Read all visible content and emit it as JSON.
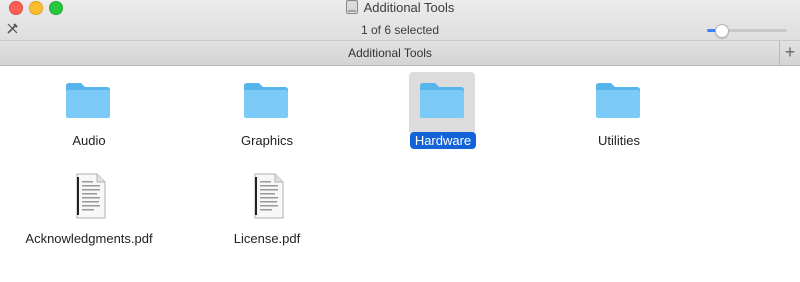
{
  "window": {
    "title": "Additional Tools",
    "title_icon": "disk-icon"
  },
  "toolbar": {
    "status": "1 of 6 selected",
    "view_options_icon": "tools-icon",
    "zoom_slider_level": 0.18
  },
  "pathbar": {
    "title": "Additional Tools",
    "add_icon": "plus-icon"
  },
  "items": [
    {
      "label": "Audio",
      "kind": "folder",
      "selected": false
    },
    {
      "label": "Graphics",
      "kind": "folder",
      "selected": false
    },
    {
      "label": "Hardware",
      "kind": "folder",
      "selected": true
    },
    {
      "label": "Utilities",
      "kind": "folder",
      "selected": false
    },
    {
      "label": "Acknowledgments.pdf",
      "kind": "pdf",
      "selected": false
    },
    {
      "label": "License.pdf",
      "kind": "pdf",
      "selected": false
    }
  ],
  "colors": {
    "folder": "#6cc3f4",
    "selection": "#1463d8",
    "accent": "#3b83f6"
  }
}
